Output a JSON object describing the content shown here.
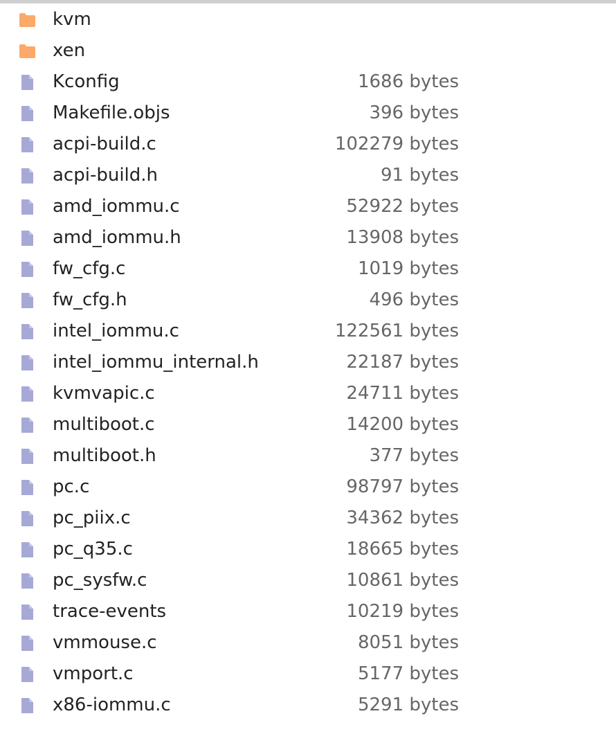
{
  "colors": {
    "folder_icon": "#fca96a",
    "file_icon": "#a6a9d6",
    "name_text": "#222222",
    "size_text": "#666666"
  },
  "entries": [
    {
      "name": "kvm",
      "type": "folder",
      "icon": "folder-icon",
      "size": ""
    },
    {
      "name": "xen",
      "type": "folder",
      "icon": "folder-icon",
      "size": ""
    },
    {
      "name": "Kconfig",
      "type": "file",
      "icon": "file-icon",
      "size": "1686 bytes"
    },
    {
      "name": "Makefile.objs",
      "type": "file",
      "icon": "file-icon",
      "size": "396 bytes"
    },
    {
      "name": "acpi-build.c",
      "type": "file",
      "icon": "file-icon",
      "size": "102279 bytes"
    },
    {
      "name": "acpi-build.h",
      "type": "file",
      "icon": "file-icon",
      "size": "91 bytes"
    },
    {
      "name": "amd_iommu.c",
      "type": "file",
      "icon": "file-icon",
      "size": "52922 bytes"
    },
    {
      "name": "amd_iommu.h",
      "type": "file",
      "icon": "file-icon",
      "size": "13908 bytes"
    },
    {
      "name": "fw_cfg.c",
      "type": "file",
      "icon": "file-icon",
      "size": "1019 bytes"
    },
    {
      "name": "fw_cfg.h",
      "type": "file",
      "icon": "file-icon",
      "size": "496 bytes"
    },
    {
      "name": "intel_iommu.c",
      "type": "file",
      "icon": "file-icon",
      "size": "122561 bytes"
    },
    {
      "name": "intel_iommu_internal.h",
      "type": "file",
      "icon": "file-icon",
      "size": "22187 bytes"
    },
    {
      "name": "kvmvapic.c",
      "type": "file",
      "icon": "file-icon",
      "size": "24711 bytes"
    },
    {
      "name": "multiboot.c",
      "type": "file",
      "icon": "file-icon",
      "size": "14200 bytes"
    },
    {
      "name": "multiboot.h",
      "type": "file",
      "icon": "file-icon",
      "size": "377 bytes"
    },
    {
      "name": "pc.c",
      "type": "file",
      "icon": "file-icon",
      "size": "98797 bytes"
    },
    {
      "name": "pc_piix.c",
      "type": "file",
      "icon": "file-icon",
      "size": "34362 bytes"
    },
    {
      "name": "pc_q35.c",
      "type": "file",
      "icon": "file-icon",
      "size": "18665 bytes"
    },
    {
      "name": "pc_sysfw.c",
      "type": "file",
      "icon": "file-icon",
      "size": "10861 bytes"
    },
    {
      "name": "trace-events",
      "type": "file",
      "icon": "file-icon",
      "size": "10219 bytes"
    },
    {
      "name": "vmmouse.c",
      "type": "file",
      "icon": "file-icon",
      "size": "8051 bytes"
    },
    {
      "name": "vmport.c",
      "type": "file",
      "icon": "file-icon",
      "size": "5177 bytes"
    },
    {
      "name": "x86-iommu.c",
      "type": "file",
      "icon": "file-icon",
      "size": "5291 bytes"
    }
  ]
}
